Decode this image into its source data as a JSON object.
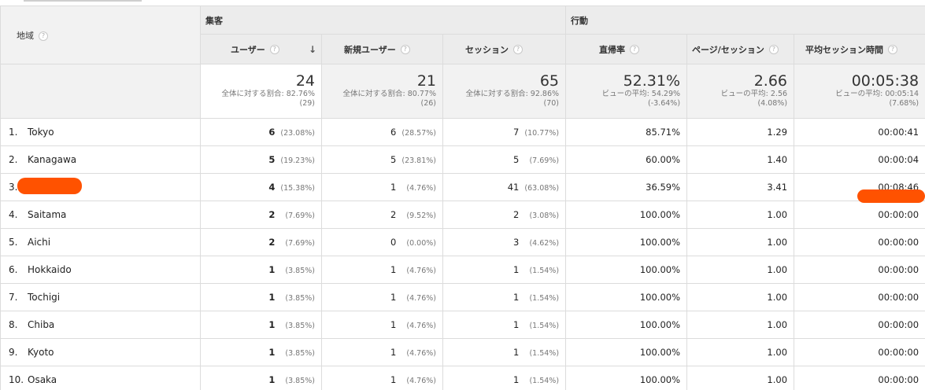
{
  "colors": {
    "redaction": "#ff5200",
    "header_bg": "#ececec",
    "totals_bg": "#f2f2f2"
  },
  "header": {
    "dimension": "地域",
    "group_acquisition": "集客",
    "group_behavior": "行動",
    "metrics": [
      "ユーザー",
      "新規ユーザー",
      "セッション",
      "直帰率",
      "ページ/セッション",
      "平均セッション時間"
    ],
    "help_icon": "question-icon",
    "sort_icon": "sort-down-arrow-icon"
  },
  "totals": {
    "users": {
      "value": "24",
      "line1": "全体に対する割合: 82.76%",
      "line2": "(29)"
    },
    "new_users": {
      "value": "21",
      "line1": "全体に対する割合: 80.77%",
      "line2": "(26)"
    },
    "sessions": {
      "value": "65",
      "line1": "全体に対する割合: 92.86%",
      "line2": "(70)"
    },
    "bounce": {
      "value": "52.31%",
      "line1": "ビューの平均: 54.29%",
      "line2": "(-3.64%)"
    },
    "pps": {
      "value": "2.66",
      "line1": "ビューの平均: 2.56",
      "line2": "(4.08%)"
    },
    "duration": {
      "value": "00:05:38",
      "line1": "ビューの平均: 00:05:14",
      "line2": "(7.68%)"
    }
  },
  "rows": [
    {
      "idx": "1.",
      "region": "Tokyo",
      "users": "6",
      "users_pct": "(23.08%)",
      "new_users": "6",
      "new_users_pct": "(28.57%)",
      "sessions": "7",
      "sessions_pct": "(10.77%)",
      "bounce": "85.71%",
      "pps": "1.29",
      "duration": "00:00:41"
    },
    {
      "idx": "2.",
      "region": "Kanagawa",
      "users": "5",
      "users_pct": "(19.23%)",
      "new_users": "5",
      "new_users_pct": "(23.81%)",
      "sessions": "5",
      "sessions_pct": "(7.69%)",
      "bounce": "60.00%",
      "pps": "1.40",
      "duration": "00:00:04"
    },
    {
      "idx": "3.",
      "region": "",
      "users": "4",
      "users_pct": "(15.38%)",
      "new_users": "1",
      "new_users_pct": "(4.76%)",
      "sessions": "41",
      "sessions_pct": "(63.08%)",
      "bounce": "36.59%",
      "pps": "3.41",
      "duration": "00:08:46"
    },
    {
      "idx": "4.",
      "region": "Saitama",
      "users": "2",
      "users_pct": "(7.69%)",
      "new_users": "2",
      "new_users_pct": "(9.52%)",
      "sessions": "2",
      "sessions_pct": "(3.08%)",
      "bounce": "100.00%",
      "pps": "1.00",
      "duration": "00:00:00"
    },
    {
      "idx": "5.",
      "region": "Aichi",
      "users": "2",
      "users_pct": "(7.69%)",
      "new_users": "0",
      "new_users_pct": "(0.00%)",
      "sessions": "3",
      "sessions_pct": "(4.62%)",
      "bounce": "100.00%",
      "pps": "1.00",
      "duration": "00:00:00"
    },
    {
      "idx": "6.",
      "region": "Hokkaido",
      "users": "1",
      "users_pct": "(3.85%)",
      "new_users": "1",
      "new_users_pct": "(4.76%)",
      "sessions": "1",
      "sessions_pct": "(1.54%)",
      "bounce": "100.00%",
      "pps": "1.00",
      "duration": "00:00:00"
    },
    {
      "idx": "7.",
      "region": "Tochigi",
      "users": "1",
      "users_pct": "(3.85%)",
      "new_users": "1",
      "new_users_pct": "(4.76%)",
      "sessions": "1",
      "sessions_pct": "(1.54%)",
      "bounce": "100.00%",
      "pps": "1.00",
      "duration": "00:00:00"
    },
    {
      "idx": "8.",
      "region": "Chiba",
      "users": "1",
      "users_pct": "(3.85%)",
      "new_users": "1",
      "new_users_pct": "(4.76%)",
      "sessions": "1",
      "sessions_pct": "(1.54%)",
      "bounce": "100.00%",
      "pps": "1.00",
      "duration": "00:00:00"
    },
    {
      "idx": "9.",
      "region": "Kyoto",
      "users": "1",
      "users_pct": "(3.85%)",
      "new_users": "1",
      "new_users_pct": "(4.76%)",
      "sessions": "1",
      "sessions_pct": "(1.54%)",
      "bounce": "100.00%",
      "pps": "1.00",
      "duration": "00:00:00"
    },
    {
      "idx": "10.",
      "region": "Osaka",
      "users": "1",
      "users_pct": "(3.85%)",
      "new_users": "1",
      "new_users_pct": "(4.76%)",
      "sessions": "1",
      "sessions_pct": "(1.54%)",
      "bounce": "100.00%",
      "pps": "1.00",
      "duration": "00:00:00"
    }
  ]
}
